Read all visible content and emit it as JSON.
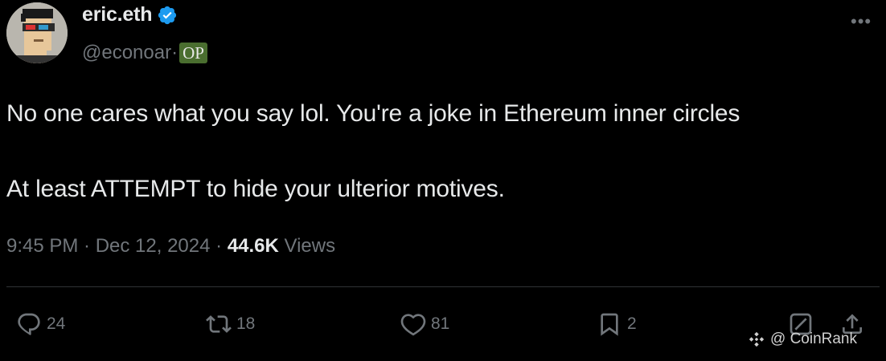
{
  "author": {
    "display_name": "eric.eth",
    "handle": "@econoar·",
    "op_badge": "OP"
  },
  "post": {
    "line1": "No one cares what you say lol. You're a joke in Ethereum inner circles",
    "line2": "At least ATTEMPT to hide your ulterior motives."
  },
  "meta": {
    "time": "9:45 PM · Dec 12, 2024 · ",
    "views_count": "44.6K",
    "views_label": " Views"
  },
  "actions": {
    "replies": "24",
    "reposts": "18",
    "likes": "81",
    "bookmarks": "2"
  },
  "watermark": {
    "text": "@ CoinRank"
  },
  "icons": [
    "verified-badge-icon",
    "more-icon",
    "reply-icon",
    "repost-icon",
    "like-icon",
    "bookmark-icon",
    "grok-icon",
    "share-icon",
    "coinrank-logo-icon"
  ],
  "colors": {
    "background": "#000000",
    "text": "#e7e9ea",
    "muted": "#71767b",
    "verified": "#1d9bf0",
    "op_badge": "#4a6e2f"
  }
}
